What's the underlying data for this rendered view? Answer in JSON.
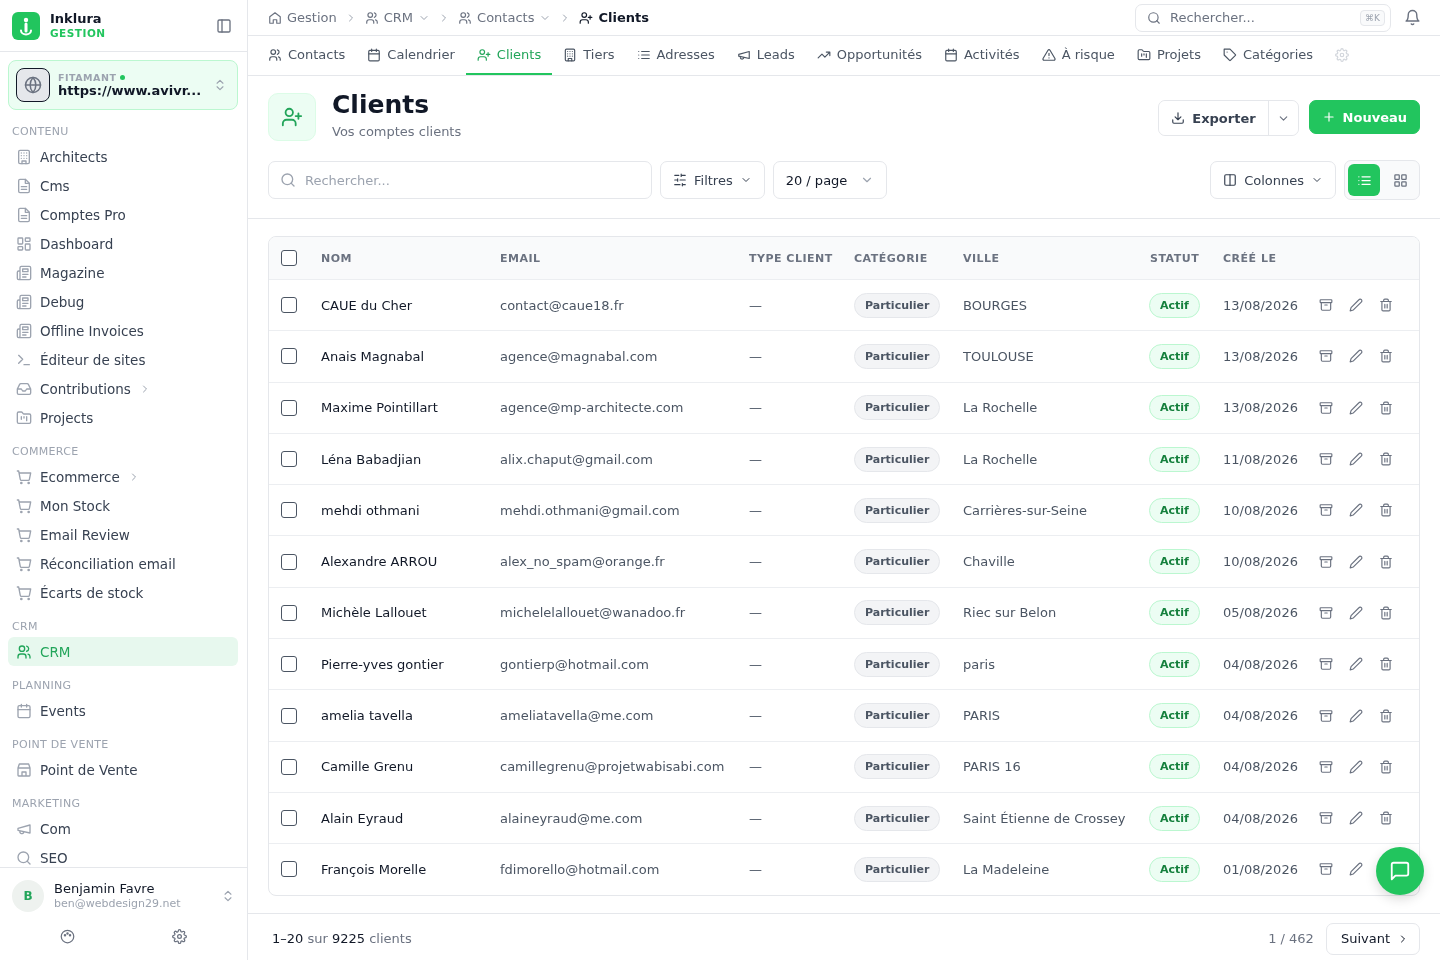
{
  "sidebar": {
    "brand": {
      "name": "Inklura",
      "subtitle": "GESTION"
    },
    "site": {
      "label": "FITAMANT",
      "online": true,
      "url": "https://www.avivr..."
    },
    "sections": [
      {
        "title": "CONTENU",
        "items": [
          {
            "label": "Architects",
            "selected": false,
            "expandable": false
          },
          {
            "label": "Cms",
            "selected": false,
            "expandable": false
          },
          {
            "label": "Comptes Pro",
            "selected": false,
            "expandable": false
          },
          {
            "label": "Dashboard",
            "selected": false,
            "expandable": false
          },
          {
            "label": "Magazine",
            "selected": false,
            "expandable": false
          },
          {
            "label": "Debug",
            "selected": false,
            "expandable": false
          },
          {
            "label": "Offline Invoices",
            "selected": false,
            "expandable": false
          },
          {
            "label": "Éditeur de sites",
            "selected": false,
            "expandable": false
          },
          {
            "label": "Contributions",
            "selected": false,
            "expandable": true
          },
          {
            "label": "Projects",
            "selected": false,
            "expandable": false
          }
        ]
      },
      {
        "title": "COMMERCE",
        "items": [
          {
            "label": "Ecommerce",
            "selected": false,
            "expandable": true
          },
          {
            "label": "Mon Stock",
            "selected": false,
            "expandable": false
          },
          {
            "label": "Email Review",
            "selected": false,
            "expandable": false
          },
          {
            "label": "Réconciliation email",
            "selected": false,
            "expandable": false
          },
          {
            "label": "Écarts de stock",
            "selected": false,
            "expandable": false
          }
        ]
      },
      {
        "title": "CRM",
        "items": [
          {
            "label": "CRM",
            "selected": true,
            "expandable": false
          }
        ]
      },
      {
        "title": "PLANNING",
        "items": [
          {
            "label": "Events",
            "selected": false,
            "expandable": false
          }
        ]
      },
      {
        "title": "POINT DE VENTE",
        "items": [
          {
            "label": "Point de Vente",
            "selected": false,
            "expandable": false
          }
        ]
      },
      {
        "title": "MARKETING",
        "items": [
          {
            "label": "Com",
            "selected": false,
            "expandable": false
          },
          {
            "label": "SEO",
            "selected": false,
            "expandable": false
          }
        ]
      }
    ],
    "user": {
      "initial": "B",
      "name": "Benjamin Favre",
      "email": "ben@webdesign29.net"
    }
  },
  "breadcrumb": [
    {
      "label": "Gestion",
      "dropdown": false,
      "current": false
    },
    {
      "label": "CRM",
      "dropdown": true,
      "current": false
    },
    {
      "label": "Contacts",
      "dropdown": true,
      "current": false
    },
    {
      "label": "Clients",
      "dropdown": false,
      "current": true
    }
  ],
  "search": {
    "placeholder": "Rechercher...",
    "shortcut": "⌘K"
  },
  "tabs": [
    {
      "kind": "tab",
      "label": "Contacts",
      "selected": false
    },
    {
      "kind": "tab",
      "label": "Calendrier",
      "selected": false
    },
    {
      "kind": "tab",
      "label": "Clients",
      "selected": true
    },
    {
      "kind": "tab",
      "label": "Tiers",
      "selected": false
    },
    {
      "kind": "tab",
      "label": "Adresses",
      "selected": false
    },
    {
      "kind": "tab",
      "label": "Leads",
      "selected": false
    },
    {
      "kind": "tab",
      "label": "Opportunités",
      "selected": false
    },
    {
      "kind": "tab",
      "label": "Activités",
      "selected": false
    },
    {
      "kind": "tab",
      "label": "À risque",
      "selected": false
    },
    {
      "kind": "tab",
      "label": "Projets",
      "selected": false
    },
    {
      "kind": "tab",
      "label": "Catégories",
      "selected": false
    },
    {
      "kind": "overflow",
      "selected": false
    }
  ],
  "page": {
    "title": "Clients",
    "subtitle": "Vos comptes clients",
    "export": "Exporter",
    "new": "Nouveau"
  },
  "toolbar": {
    "search_placeholder": "Rechercher...",
    "filters": "Filtres",
    "page_size": "20 / page",
    "columns": "Colonnes",
    "views": [
      {
        "kind": "list",
        "selected": true
      },
      {
        "kind": "grid",
        "selected": false
      }
    ]
  },
  "table": {
    "all_checked": false,
    "columns": [
      "NOM",
      "EMAIL",
      "TYPE CLIENT",
      "CATÉGORIE",
      "VILLE",
      "STATUT",
      "CRÉÉ LE"
    ],
    "rows": [
      {
        "checked": false,
        "name": "CAUE du Cher",
        "email": "contact@caue18.fr",
        "type": "—",
        "category": "Particulier",
        "city": "BOURGES",
        "status": "Actif",
        "created": "13/08/2026"
      },
      {
        "checked": false,
        "name": "Anais Magnabal",
        "email": "agence@magnabal.com",
        "type": "—",
        "category": "Particulier",
        "city": "TOULOUSE",
        "status": "Actif",
        "created": "13/08/2026"
      },
      {
        "checked": false,
        "name": "Maxime Pointillart",
        "email": "agence@mp-architecte.com",
        "type": "—",
        "category": "Particulier",
        "city": "La Rochelle",
        "status": "Actif",
        "created": "13/08/2026"
      },
      {
        "checked": false,
        "name": "Léna Babadjian",
        "email": "alix.chaput@gmail.com",
        "type": "—",
        "category": "Particulier",
        "city": "La Rochelle",
        "status": "Actif",
        "created": "11/08/2026"
      },
      {
        "checked": false,
        "name": "mehdi othmani",
        "email": "mehdi.othmani@gmail.com",
        "type": "—",
        "category": "Particulier",
        "city": "Carrières-sur-Seine",
        "status": "Actif",
        "created": "10/08/2026"
      },
      {
        "checked": false,
        "name": "Alexandre ARROU",
        "email": "alex_no_spam@orange.fr",
        "type": "—",
        "category": "Particulier",
        "city": "Chaville",
        "status": "Actif",
        "created": "10/08/2026"
      },
      {
        "checked": false,
        "name": "Michèle Lallouet",
        "email": "michelelallouet@wanadoo.fr",
        "type": "—",
        "category": "Particulier",
        "city": "Riec sur Belon",
        "status": "Actif",
        "created": "05/08/2026"
      },
      {
        "checked": false,
        "name": "Pierre-yves gontier",
        "email": "gontierp@hotmail.com",
        "type": "—",
        "category": "Particulier",
        "city": "paris",
        "status": "Actif",
        "created": "04/08/2026"
      },
      {
        "checked": false,
        "name": "amelia tavella",
        "email": "ameliatavella@me.com",
        "type": "—",
        "category": "Particulier",
        "city": "PARIS",
        "status": "Actif",
        "created": "04/08/2026"
      },
      {
        "checked": false,
        "name": "Camille Grenu",
        "email": "camillegrenu@projetwabisabi.com",
        "type": "—",
        "category": "Particulier",
        "city": "PARIS 16",
        "status": "Actif",
        "created": "04/08/2026"
      },
      {
        "checked": false,
        "name": "Alain Eyraud",
        "email": "alaineyraud@me.com",
        "type": "—",
        "category": "Particulier",
        "city": "Saint Étienne de Crossey",
        "status": "Actif",
        "created": "04/08/2026"
      },
      {
        "checked": false,
        "name": "François Morelle",
        "email": "fdimorello@hotmail.com",
        "type": "—",
        "category": "Particulier",
        "city": "La Madeleine",
        "status": "Actif",
        "created": "01/08/2026"
      }
    ]
  },
  "footer": {
    "summary": "**1–20** sur **9225** clients",
    "page": "1 / 462",
    "next": "Suivant"
  }
}
